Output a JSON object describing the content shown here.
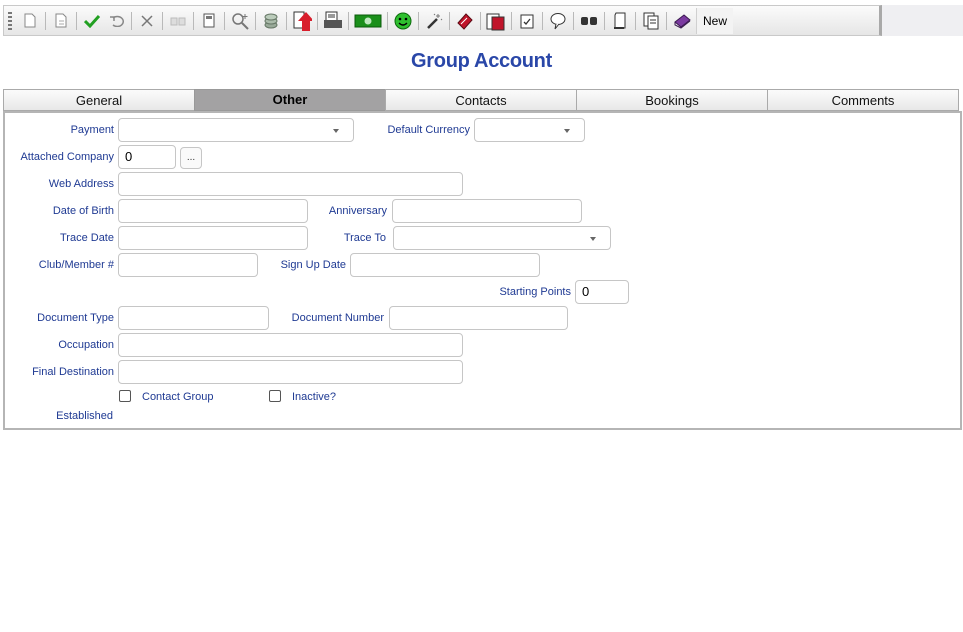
{
  "toolbar": {
    "new_label": "New",
    "icons": [
      "grip-icon",
      "new-document-icon",
      "copy-document-icon",
      "save-check-icon",
      "undo-icon",
      "delete-x-icon",
      "binoculars-disabled-icon",
      "calculator-icon",
      "search-plus-icon",
      "coins-icon",
      "export-arrow-icon",
      "print-icon",
      "money-icon",
      "smiley-icon",
      "magic-wand-icon",
      "book-red-icon",
      "documents-icon",
      "clipboard-check-icon",
      "speech-bubble-icon",
      "binoculars-icon",
      "scroll-icon",
      "document-stack-icon",
      "book-purple-icon"
    ],
    "colors": {
      "check": "#22a022",
      "arrow": "#d81e2c",
      "money": "#1a8f1a",
      "smiley": "#2fbf2f"
    }
  },
  "page": {
    "title": "Group Account"
  },
  "tabs": [
    {
      "label": "General"
    },
    {
      "label": "Other",
      "active": true
    },
    {
      "label": "Contacts"
    },
    {
      "label": "Bookings"
    },
    {
      "label": "Comments"
    }
  ],
  "form": {
    "payment": {
      "label": "Payment",
      "value": ""
    },
    "default_currency": {
      "label": "Default Currency",
      "value": ""
    },
    "attached_company": {
      "label": "Attached Company",
      "value": "0",
      "browse": "..."
    },
    "web_address": {
      "label": "Web Address",
      "value": ""
    },
    "date_of_birth": {
      "label": "Date of Birth",
      "value": ""
    },
    "anniversary": {
      "label": "Anniversary",
      "value": ""
    },
    "trace_date": {
      "label": "Trace Date",
      "value": ""
    },
    "trace_to": {
      "label": "Trace To",
      "value": ""
    },
    "club_member": {
      "label": "Club/Member #",
      "value": ""
    },
    "sign_up_date": {
      "label": "Sign Up Date",
      "value": ""
    },
    "starting_points": {
      "label": "Starting Points",
      "value": "0"
    },
    "document_type": {
      "label": "Document Type",
      "value": ""
    },
    "document_number": {
      "label": "Document Number",
      "value": ""
    },
    "occupation": {
      "label": "Occupation",
      "value": ""
    },
    "final_destination": {
      "label": "Final Destination",
      "value": ""
    },
    "contact_group": {
      "label": "Contact Group",
      "checked": false
    },
    "inactive": {
      "label": "Inactive?",
      "checked": false
    },
    "established": {
      "label": "Established"
    }
  }
}
